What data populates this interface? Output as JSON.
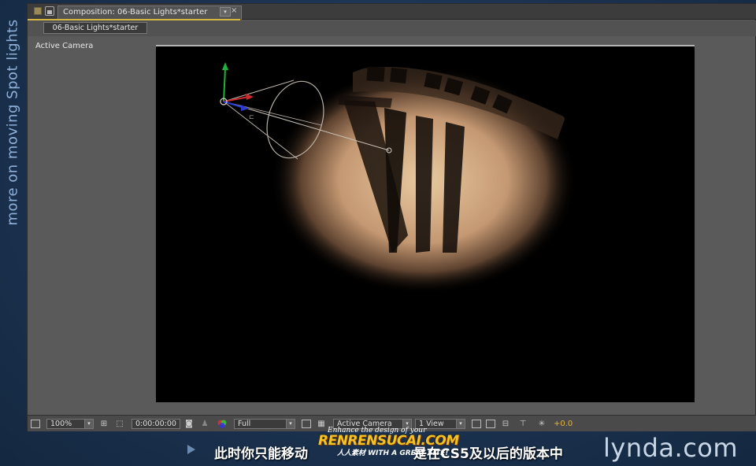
{
  "side_caption": "more on moving Spot lights",
  "composition_tab": {
    "title": "Composition: 06-Basic Lights*starter",
    "dropdown_glyph": "▾",
    "close_glyph": "×"
  },
  "viewer_tab": "06-Basic Lights*starter",
  "view_label": "Active Camera",
  "toolbar": {
    "magnification": "100%",
    "timecode": "0:00:00:00",
    "resolution": "Full",
    "camera_view": "Active Camera",
    "view_layout": "1 View",
    "exposure": "+0.0",
    "arrow_glyph": "▾"
  },
  "subtitle": "此时你只能移动",
  "subtitle_tail": "是在CS5及以后的版本中",
  "watermark": {
    "top": "Enhance the design of your",
    "main": "RENRENSUCAI.COM",
    "bottom": "人人素材 WITH A GREAT SITE!"
  },
  "brand": "lynda.com",
  "icons": {
    "grip": "panel-grip-icon",
    "lock": "lock-icon",
    "snapshot": "camera-snapshot-icon",
    "color": "color-channels-icon",
    "transparency": "transparency-grid-icon",
    "play": "play-icon",
    "light": "spotlight-icon"
  }
}
